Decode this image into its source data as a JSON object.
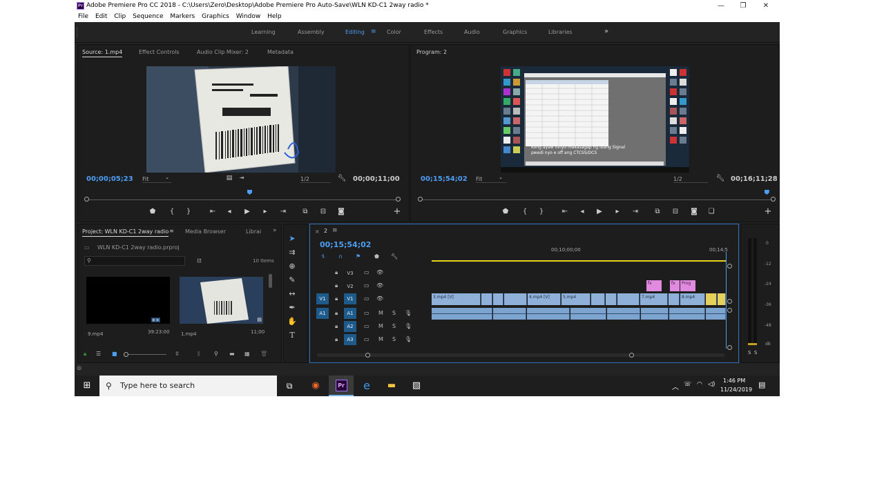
{
  "window": {
    "title": "Adobe Premiere Pro CC 2018 - C:\\Users\\Zero\\Desktop\\Adobe Premiere Pro Auto-Save\\WLN KD-C1 2way radio *",
    "app_logo": "Pr"
  },
  "menu": [
    "File",
    "Edit",
    "Clip",
    "Sequence",
    "Markers",
    "Graphics",
    "Window",
    "Help"
  ],
  "workspaces": {
    "items": [
      "Learning",
      "Assembly",
      "Editing",
      "Color",
      "Effects",
      "Audio",
      "Graphics",
      "Libraries"
    ],
    "active": "Editing",
    "more": "»"
  },
  "source_panel": {
    "tabs": [
      "Source: 1.mp4",
      "Effect Controls",
      "Audio Clip Mixer: 2",
      "Metadata"
    ],
    "timecode": "00;00;05;23",
    "fit": "Fit",
    "resolution": "1/2",
    "duration": "00;00;11;00",
    "playhead_fraction": 0.52
  },
  "program_panel": {
    "tabs": [
      "Program: 2"
    ],
    "timecode": "00;15;54;02",
    "fit": "Fit",
    "resolution": "1/2",
    "duration": "00;16;11;28",
    "playhead_fraction": 0.98,
    "overlay_text": [
      "Kong ayaw ninyo makasagap ng ibang Signal",
      "pwedi nyo e off ang CTCSS/DCS"
    ]
  },
  "project_panel": {
    "tabs": [
      "Project: WLN KD-C1 2way radio",
      "Media Browser",
      "Librai"
    ],
    "file": "WLN KD-C1 2way radio.prproj",
    "items_count": "10 Items",
    "clips": [
      {
        "name": "9.mp4",
        "duration": "39:23:00"
      },
      {
        "name": "1.mp4",
        "duration": "11;00"
      }
    ]
  },
  "timeline": {
    "sequence": "2",
    "timecode": "00;15;54;02",
    "ruler": [
      "00;10;00;00",
      "00;14;5"
    ],
    "video_tracks": [
      "V3",
      "V2",
      "V1"
    ],
    "audio_tracks": [
      "A1",
      "A2",
      "A3"
    ],
    "source_patch_video": "V1",
    "source_patch_audio": "A1",
    "v1_clip_labels": [
      "3.mp4 [V]",
      "4.mp4 [V]",
      "5.mp4",
      "7.mp4",
      "8.mp4"
    ],
    "v2_clip_labels": [
      "fx",
      "fx",
      "Prog"
    ],
    "mute": "M",
    "solo": "S"
  },
  "audio_meter": {
    "scale": [
      "0",
      "-12",
      "-24",
      "-36",
      "-48",
      "dB"
    ],
    "solo": [
      "S",
      "S"
    ]
  },
  "taskbar": {
    "search_placeholder": "Type here to search",
    "time": "1:46 PM",
    "date": "11/24/2019"
  },
  "colors": {
    "accent": "#4d9ef5",
    "panel": "#1d1d1d",
    "clip_video": "#8fb1d9",
    "clip_fx": "#e08be0"
  }
}
